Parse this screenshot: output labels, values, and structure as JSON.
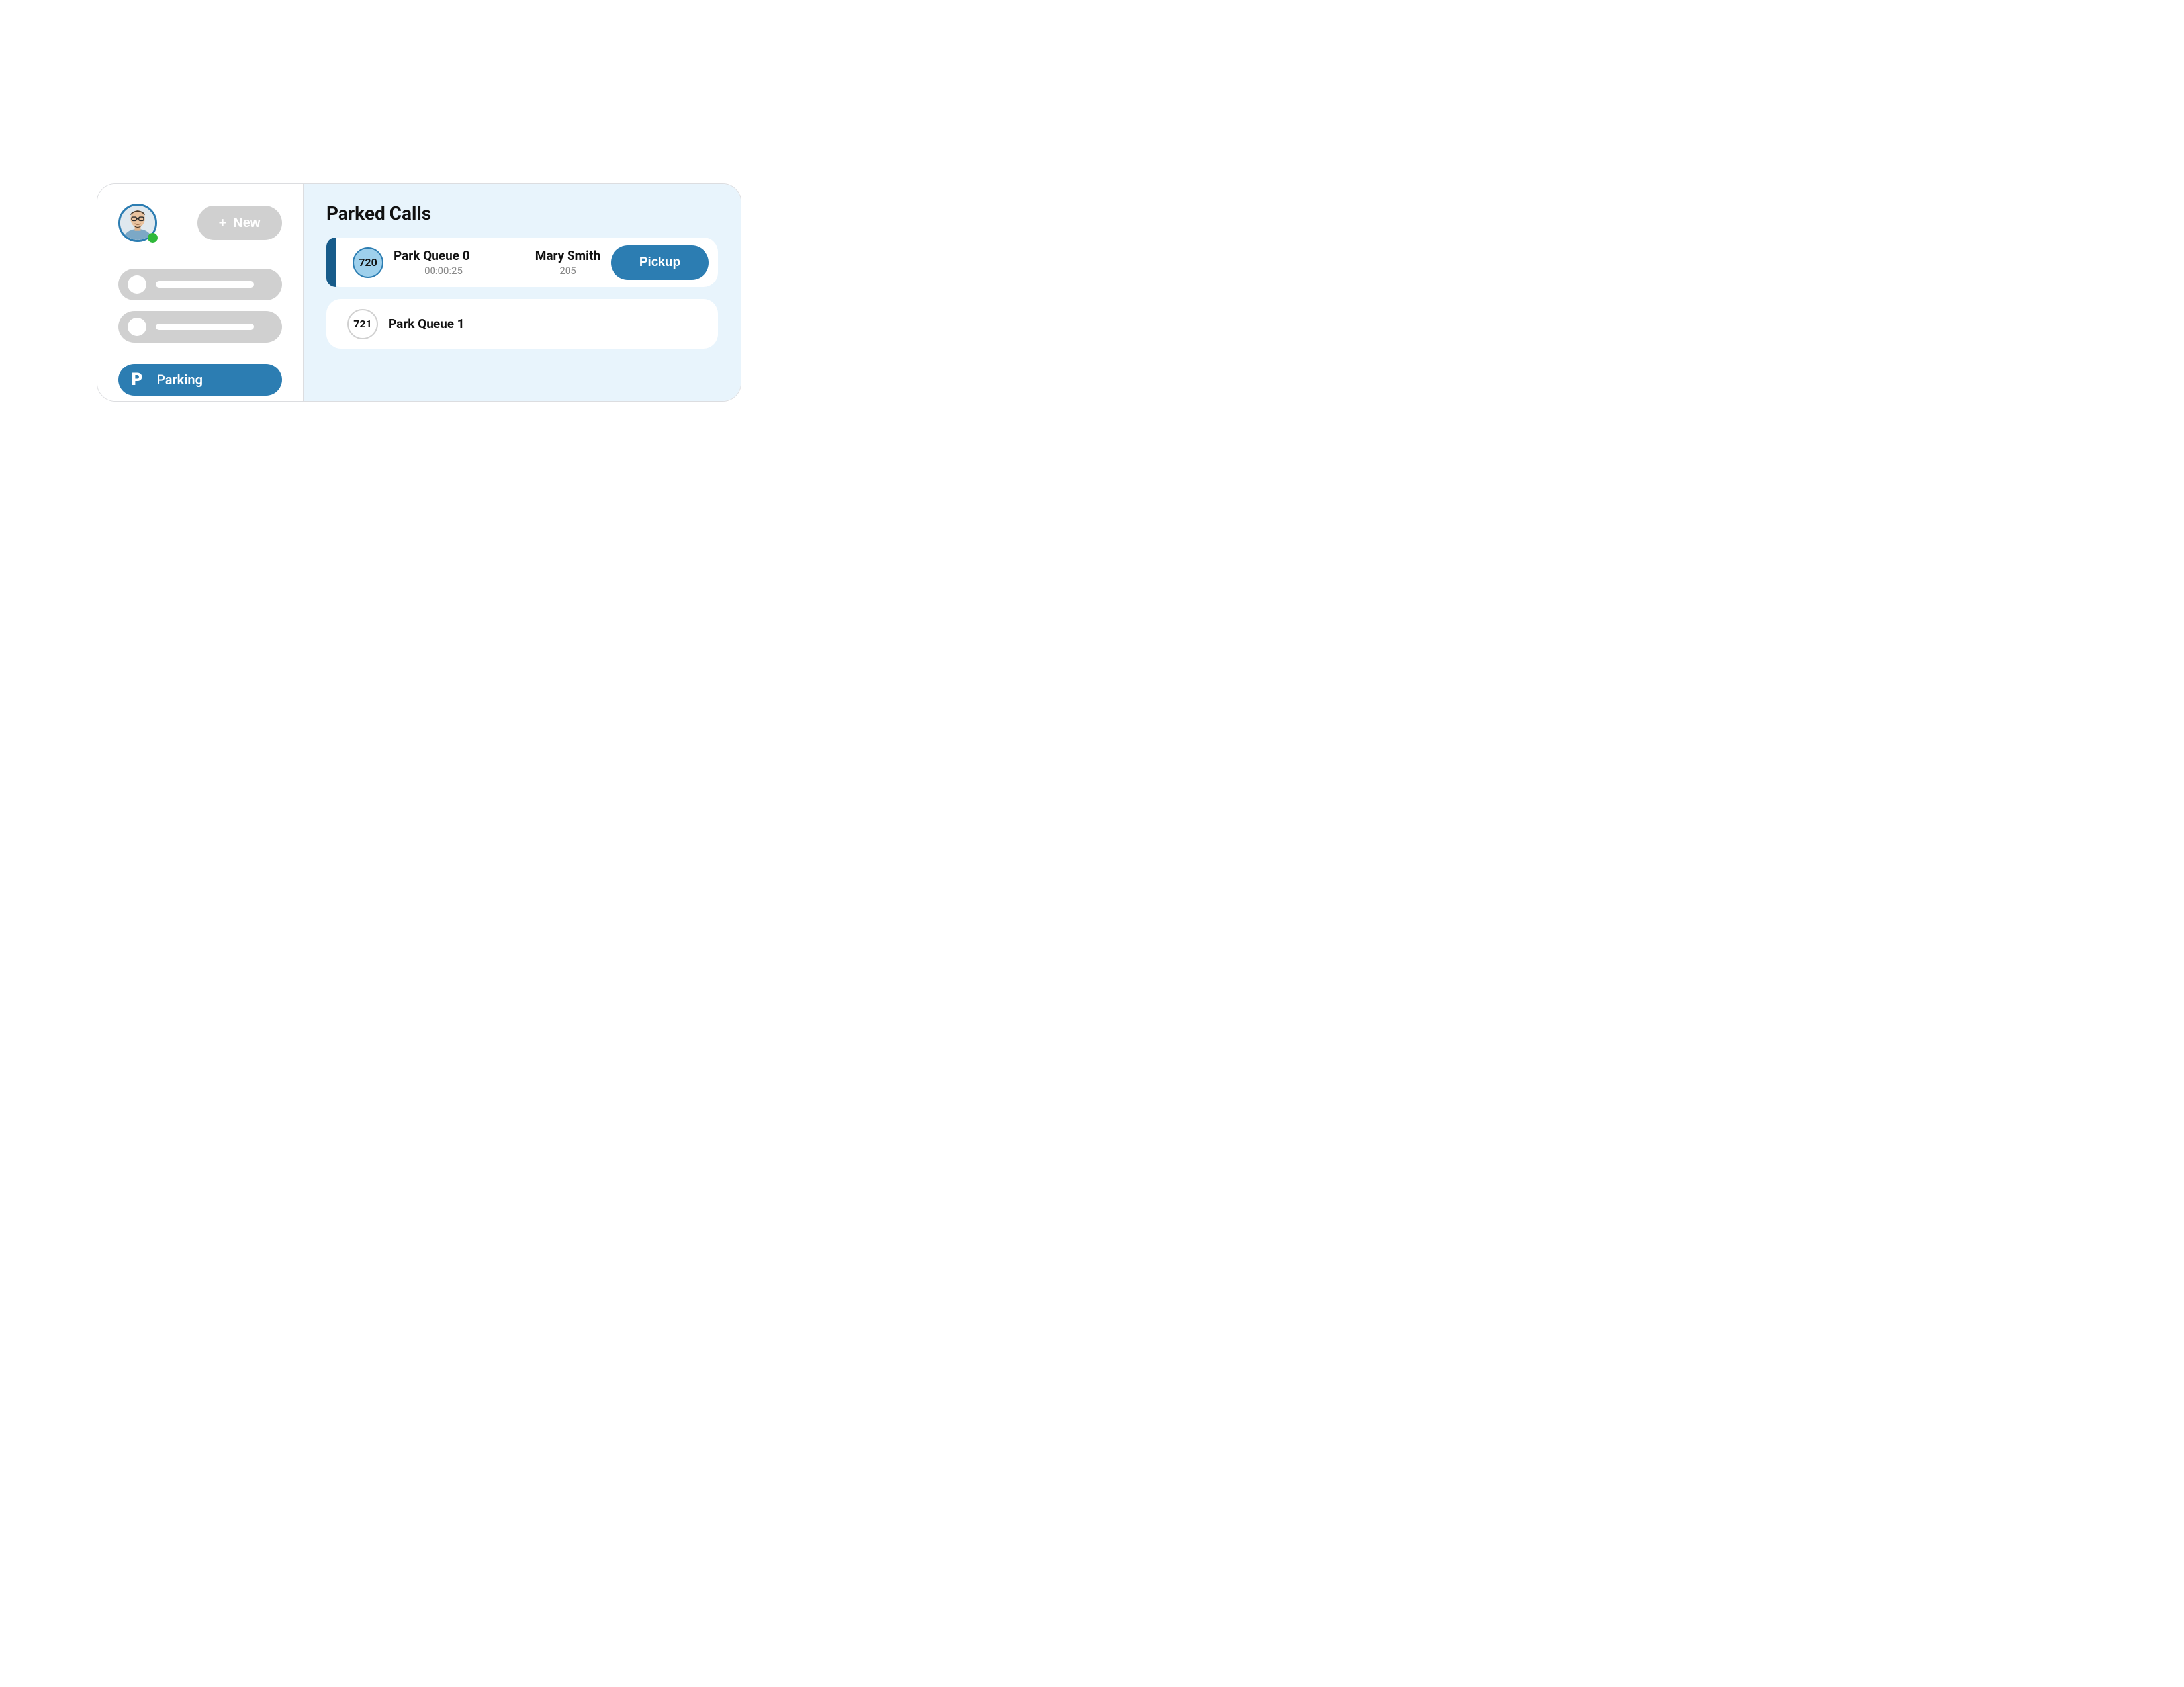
{
  "sidebar": {
    "new_button_label": "New",
    "parking_label": "Parking",
    "parking_icon_glyph": "P"
  },
  "main": {
    "title": "Parked Calls"
  },
  "calls": [
    {
      "id": "720",
      "queue": "Park Queue 0",
      "time": "00:00:25",
      "caller_name": "Mary Smith",
      "caller_ext": "205",
      "pickup_label": "Pickup"
    },
    {
      "id": "721",
      "queue": "Park Queue 1"
    }
  ],
  "colors": {
    "brand": "#2c7db2",
    "brand_dark": "#175b8a",
    "panel_bg": "#e8f4fc",
    "placeholder": "#d0d0d0",
    "online": "#2fb83a"
  }
}
